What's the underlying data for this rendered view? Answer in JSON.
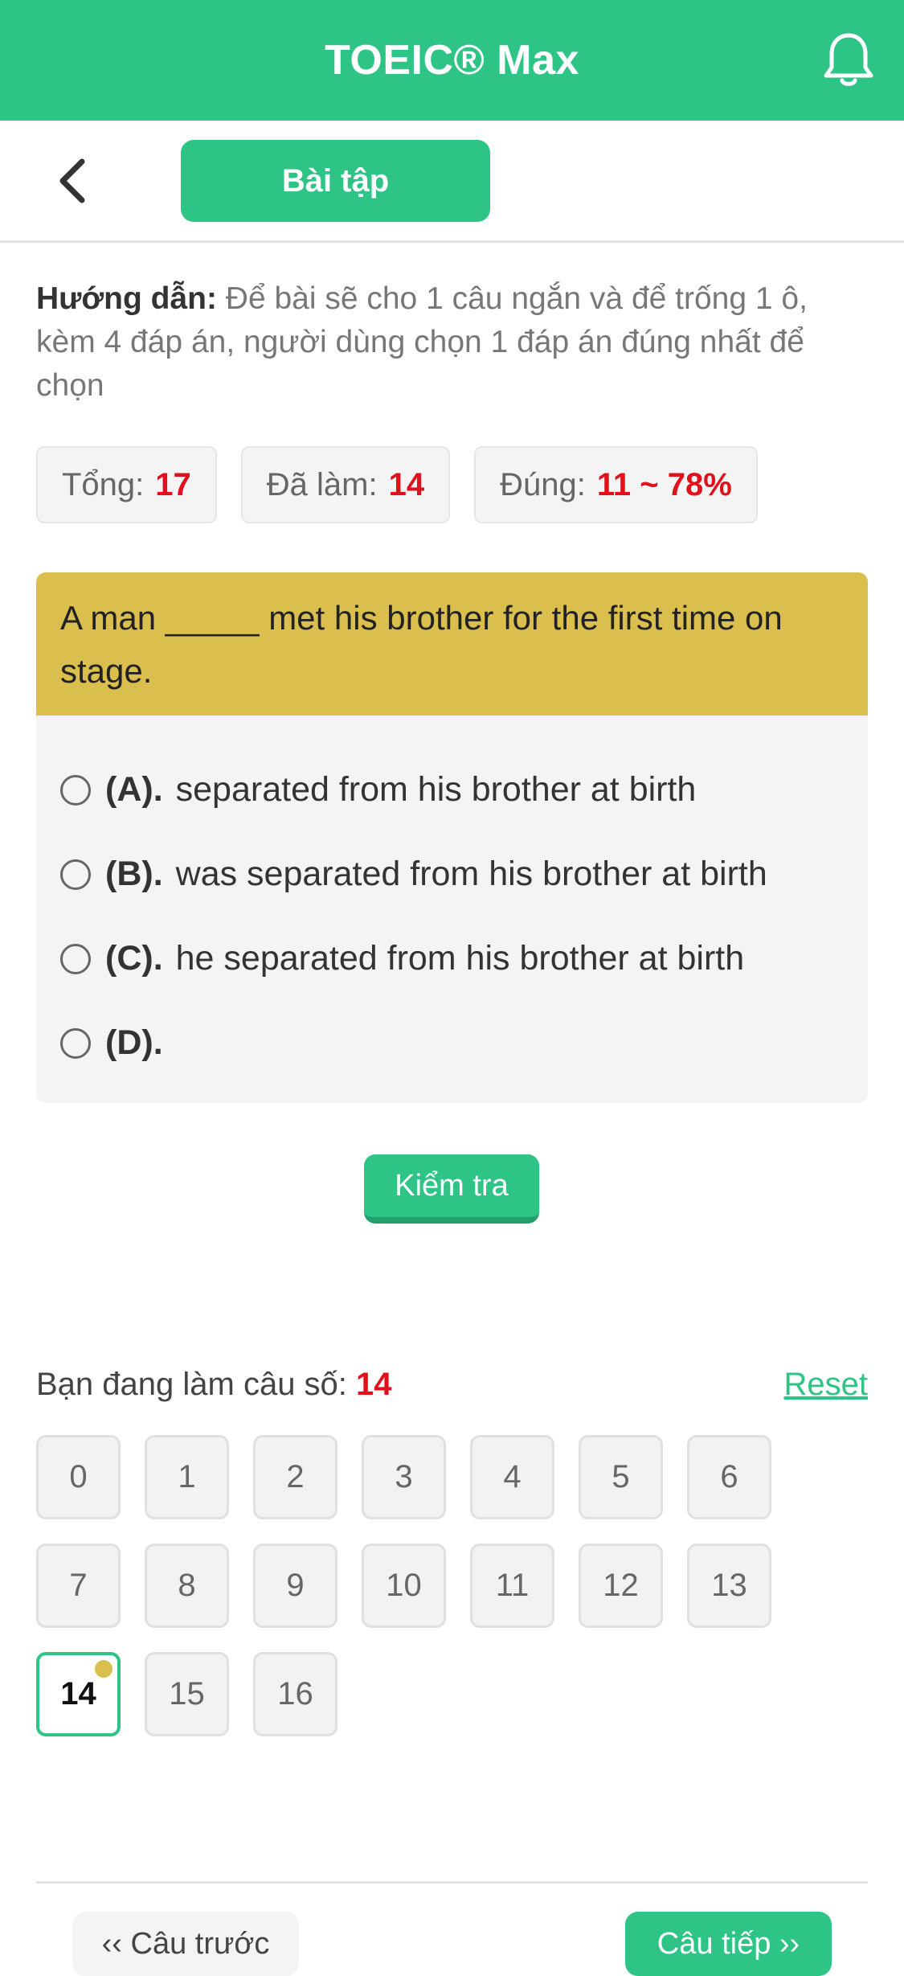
{
  "header": {
    "title": "TOEIC® Max",
    "bell_icon": "bell-icon"
  },
  "subbar": {
    "back_icon": "chevron-left-icon",
    "tab_label": "Bài tập"
  },
  "instructions": {
    "label": "Hướng dẫn:",
    "text": " Để bài sẽ cho 1 câu ngắn và để trống 1 ô, kèm 4 đáp án, người dùng chọn 1 đáp án đúng nhất để chọn"
  },
  "stats": {
    "total_label": "Tổng:",
    "total_value": "17",
    "done_label": "Đã làm:",
    "done_value": "14",
    "correct_label": "Đúng:",
    "correct_value": "11 ~ 78%"
  },
  "question": {
    "text": "A man _____ met his brother for the first time on stage.",
    "options": [
      {
        "letter": "(A).",
        "text": "separated from his brother at birth"
      },
      {
        "letter": "(B).",
        "text": "was separated from his brother at birth"
      },
      {
        "letter": "(C).",
        "text": "he separated from his brother at birth"
      },
      {
        "letter": "(D).",
        "text": ""
      }
    ]
  },
  "check_button": "Kiểm tra",
  "navigator": {
    "label": "Bạn đang làm câu số:",
    "current": "14",
    "reset": "Reset",
    "numbers": [
      "0",
      "1",
      "2",
      "3",
      "4",
      "5",
      "6",
      "7",
      "8",
      "9",
      "10",
      "11",
      "12",
      "13",
      "14",
      "15",
      "16"
    ]
  },
  "footer": {
    "prev": "‹‹ Câu trước",
    "next": "Câu tiếp ››"
  },
  "colors": {
    "brand": "#2ec486",
    "question_bg": "#dbbf4e",
    "highlight": "#e0101c"
  }
}
